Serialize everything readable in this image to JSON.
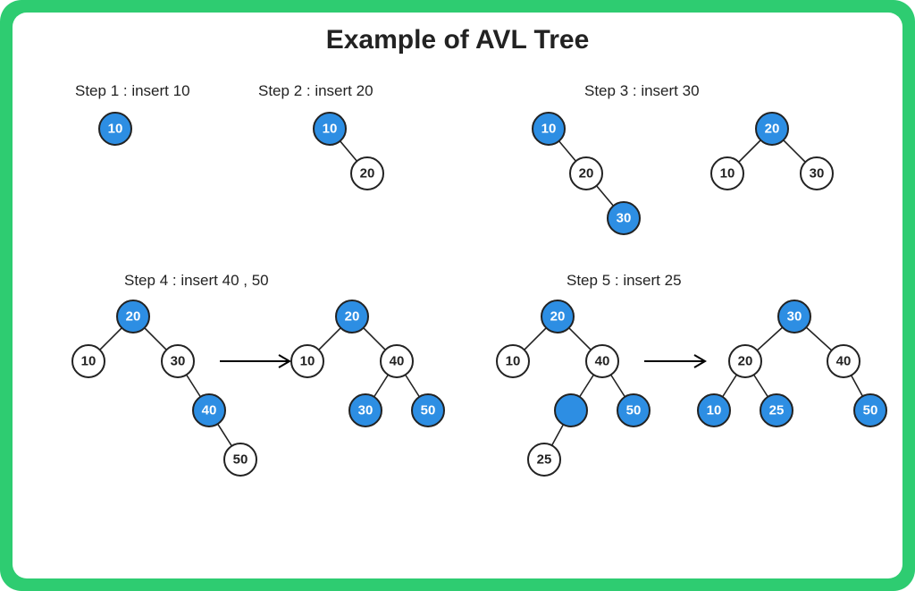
{
  "title": "Example of AVL Tree",
  "colors": {
    "border": "#2ecc71",
    "node_accent": "#2d8ee3",
    "node_plain": "#ffffff",
    "stroke": "#222222"
  },
  "steps": {
    "s1": {
      "label": "Step 1 : insert 10"
    },
    "s2": {
      "label": "Step 2 : insert 20"
    },
    "s3": {
      "label": "Step 3 : insert 30"
    },
    "s4": {
      "label": "Step 4 : insert 40 , 50"
    },
    "s5": {
      "label": "Step 5 : insert 25"
    }
  },
  "trees": {
    "s1": {
      "nodes": {
        "n10": "10"
      }
    },
    "s2": {
      "nodes": {
        "n10": "10",
        "n20": "20"
      }
    },
    "s3a": {
      "nodes": {
        "n10": "10",
        "n20": "20",
        "n30": "30"
      }
    },
    "s3b": {
      "nodes": {
        "n10": "10",
        "n20": "20",
        "n30": "30"
      }
    },
    "s4a": {
      "nodes": {
        "n10": "10",
        "n20": "20",
        "n30": "30",
        "n40": "40",
        "n50": "50"
      }
    },
    "s4b": {
      "nodes": {
        "n10": "10",
        "n20": "20",
        "n30": "30",
        "n40": "40",
        "n50": "50"
      }
    },
    "s5a": {
      "nodes": {
        "n10": "10",
        "n20": "20",
        "n25b": "",
        "n40": "40",
        "n50": "50",
        "n25": "25"
      }
    },
    "s5b": {
      "nodes": {
        "n10": "10",
        "n20": "20",
        "n25": "25",
        "n30": "30",
        "n40": "40",
        "n50": "50"
      }
    }
  },
  "chart_data": {
    "type": "diagram",
    "description": "AVL tree insertion sequence with rotations",
    "insert_sequence": [
      10,
      20,
      30,
      40,
      50,
      25
    ],
    "steps": [
      {
        "step": 1,
        "insert": [
          10
        ],
        "result_tree": {
          "value": 10
        }
      },
      {
        "step": 2,
        "insert": [
          20
        ],
        "result_tree": {
          "value": 10,
          "right": {
            "value": 20
          }
        }
      },
      {
        "step": 3,
        "insert": [
          30
        ],
        "before_rotation": {
          "value": 10,
          "right": {
            "value": 20,
            "right": {
              "value": 30
            }
          }
        },
        "after_rotation": {
          "value": 20,
          "left": {
            "value": 10
          },
          "right": {
            "value": 30
          }
        }
      },
      {
        "step": 4,
        "insert": [
          40,
          50
        ],
        "before_rotation": {
          "value": 20,
          "left": {
            "value": 10
          },
          "right": {
            "value": 30,
            "right": {
              "value": 40,
              "right": {
                "value": 50
              }
            }
          }
        },
        "after_rotation": {
          "value": 20,
          "left": {
            "value": 10
          },
          "right": {
            "value": 40,
            "left": {
              "value": 30
            },
            "right": {
              "value": 50
            }
          }
        }
      },
      {
        "step": 5,
        "insert": [
          25
        ],
        "before_rotation": {
          "value": 20,
          "left": {
            "value": 10
          },
          "right": {
            "value": 40,
            "left": {
              "value": 25
            },
            "right": {
              "value": 50
            }
          }
        },
        "after_rotation": {
          "value": 30,
          "left": {
            "value": 20,
            "left": {
              "value": 10
            },
            "right": {
              "value": 25
            }
          },
          "right": {
            "value": 40,
            "right": {
              "value": 50
            }
          }
        }
      }
    ]
  }
}
